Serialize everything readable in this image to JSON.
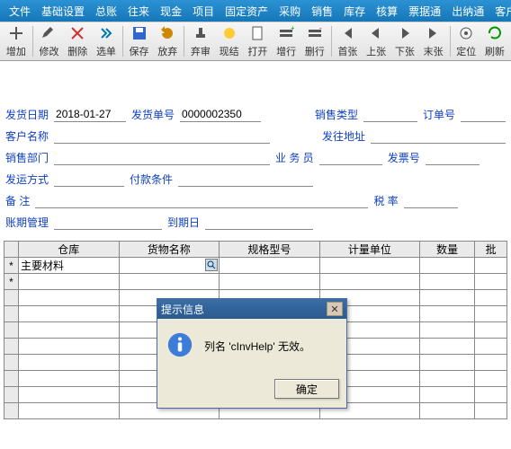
{
  "menu": [
    "文件",
    "基础设置",
    "总账",
    "往来",
    "现金",
    "项目",
    "固定资产",
    "采购",
    "销售",
    "库存",
    "核算",
    "票据通",
    "出纳通",
    "客户通"
  ],
  "toolbar": [
    {
      "id": "add",
      "label": "增加",
      "icon": "plus"
    },
    {
      "sep": true
    },
    {
      "id": "edit",
      "label": "修改",
      "icon": "pencil"
    },
    {
      "id": "delete",
      "label": "删除",
      "icon": "x"
    },
    {
      "id": "select",
      "label": "选单",
      "icon": "chevrons"
    },
    {
      "sep": true
    },
    {
      "id": "save",
      "label": "保存",
      "icon": "floppy"
    },
    {
      "id": "abandon",
      "label": "放弃",
      "icon": "undo"
    },
    {
      "sep": true
    },
    {
      "id": "shenpi",
      "label": "弃审",
      "icon": "stamp"
    },
    {
      "id": "xianjie",
      "label": "现结",
      "icon": "coin"
    },
    {
      "id": "print",
      "label": "打开",
      "icon": "doc"
    },
    {
      "id": "addrow",
      "label": "增行",
      "icon": "rowplus"
    },
    {
      "id": "delrow",
      "label": "删行",
      "icon": "rowminus"
    },
    {
      "sep": true
    },
    {
      "id": "first",
      "label": "首张",
      "icon": "first"
    },
    {
      "id": "prev",
      "label": "上张",
      "icon": "prev"
    },
    {
      "id": "next",
      "label": "下张",
      "icon": "next"
    },
    {
      "id": "last",
      "label": "末张",
      "icon": "last"
    },
    {
      "sep": true
    },
    {
      "id": "locate",
      "label": "定位",
      "icon": "target"
    },
    {
      "id": "refresh",
      "label": "刷新",
      "icon": "refresh"
    }
  ],
  "form": {
    "shipDate": {
      "label": "发货日期",
      "value": "2018-01-27"
    },
    "shipNo": {
      "label": "发货单号",
      "value": "0000002350"
    },
    "saleType": {
      "label": "销售类型",
      "value": ""
    },
    "orderNo": {
      "label": "订单号",
      "value": ""
    },
    "custName": {
      "label": "客户名称",
      "value": ""
    },
    "shipAddr": {
      "label": "发往地址",
      "value": ""
    },
    "saleDept": {
      "label": "销售部门",
      "value": ""
    },
    "salesman": {
      "label": "业 务 员",
      "value": ""
    },
    "invoiceNo": {
      "label": "发票号",
      "value": ""
    },
    "shipMethod": {
      "label": "发运方式",
      "value": ""
    },
    "payTerms": {
      "label": "付款条件",
      "value": ""
    },
    "remark": {
      "label": "备    注",
      "value": ""
    },
    "taxRate": {
      "label": "税  率",
      "value": ""
    },
    "periodMgr": {
      "label": "账期管理",
      "value": ""
    },
    "dueDate": {
      "label": "到期日",
      "value": ""
    }
  },
  "grid": {
    "columns": [
      "仓库",
      "货物名称",
      "规格型号",
      "计量单位",
      "数量",
      "批"
    ],
    "rows": [
      {
        "mark": "*",
        "c0": "主要材料",
        "c1": "",
        "c2": "",
        "c3": "",
        "c4": ""
      }
    ],
    "blankRows": 9
  },
  "dialog": {
    "title": "提示信息",
    "message": "列名 'cInvHelp' 无效。",
    "ok": "确定"
  }
}
